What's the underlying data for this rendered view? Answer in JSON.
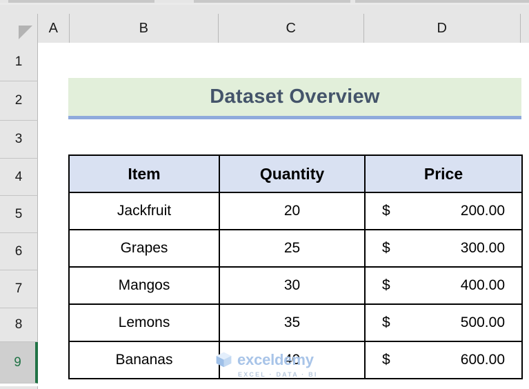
{
  "app": {
    "name": "Microsoft Excel",
    "gridlines_visible": false
  },
  "grid": {
    "column_headers": [
      "A",
      "B",
      "C",
      "D",
      ""
    ],
    "row_headers": [
      "1",
      "2",
      "3",
      "4",
      "5",
      "6",
      "7",
      "8",
      "9"
    ],
    "selected_row": "9",
    "selection_accent_color": "#217346",
    "header_background": "#e6e6e6"
  },
  "title_banner": {
    "text": "Dataset Overview",
    "background_color": "#e2efda",
    "text_color": "#44546a",
    "bottom_border_color": "#8faadc"
  },
  "table": {
    "headers": [
      "Item",
      "Quantity",
      "Price"
    ],
    "header_background": "#d9e1f2",
    "border_color": "#000000",
    "rows": [
      {
        "item": "Jackfruit",
        "quantity": "20",
        "currency": "$",
        "price": "200.00"
      },
      {
        "item": "Grapes",
        "quantity": "25",
        "currency": "$",
        "price": "300.00"
      },
      {
        "item": "Mangos",
        "quantity": "30",
        "currency": "$",
        "price": "400.00"
      },
      {
        "item": "Lemons",
        "quantity": "35",
        "currency": "$",
        "price": "500.00"
      },
      {
        "item": "Bananas",
        "quantity": "40",
        "currency": "$",
        "price": "600.00"
      }
    ]
  },
  "watermark": {
    "logo_icon": "cube-logo-icon",
    "name": "exceldemy",
    "tagline": "EXCEL · DATA · BI",
    "color": "#a8c4e8"
  },
  "icons": {
    "select_all": "select-all-triangle-icon"
  }
}
